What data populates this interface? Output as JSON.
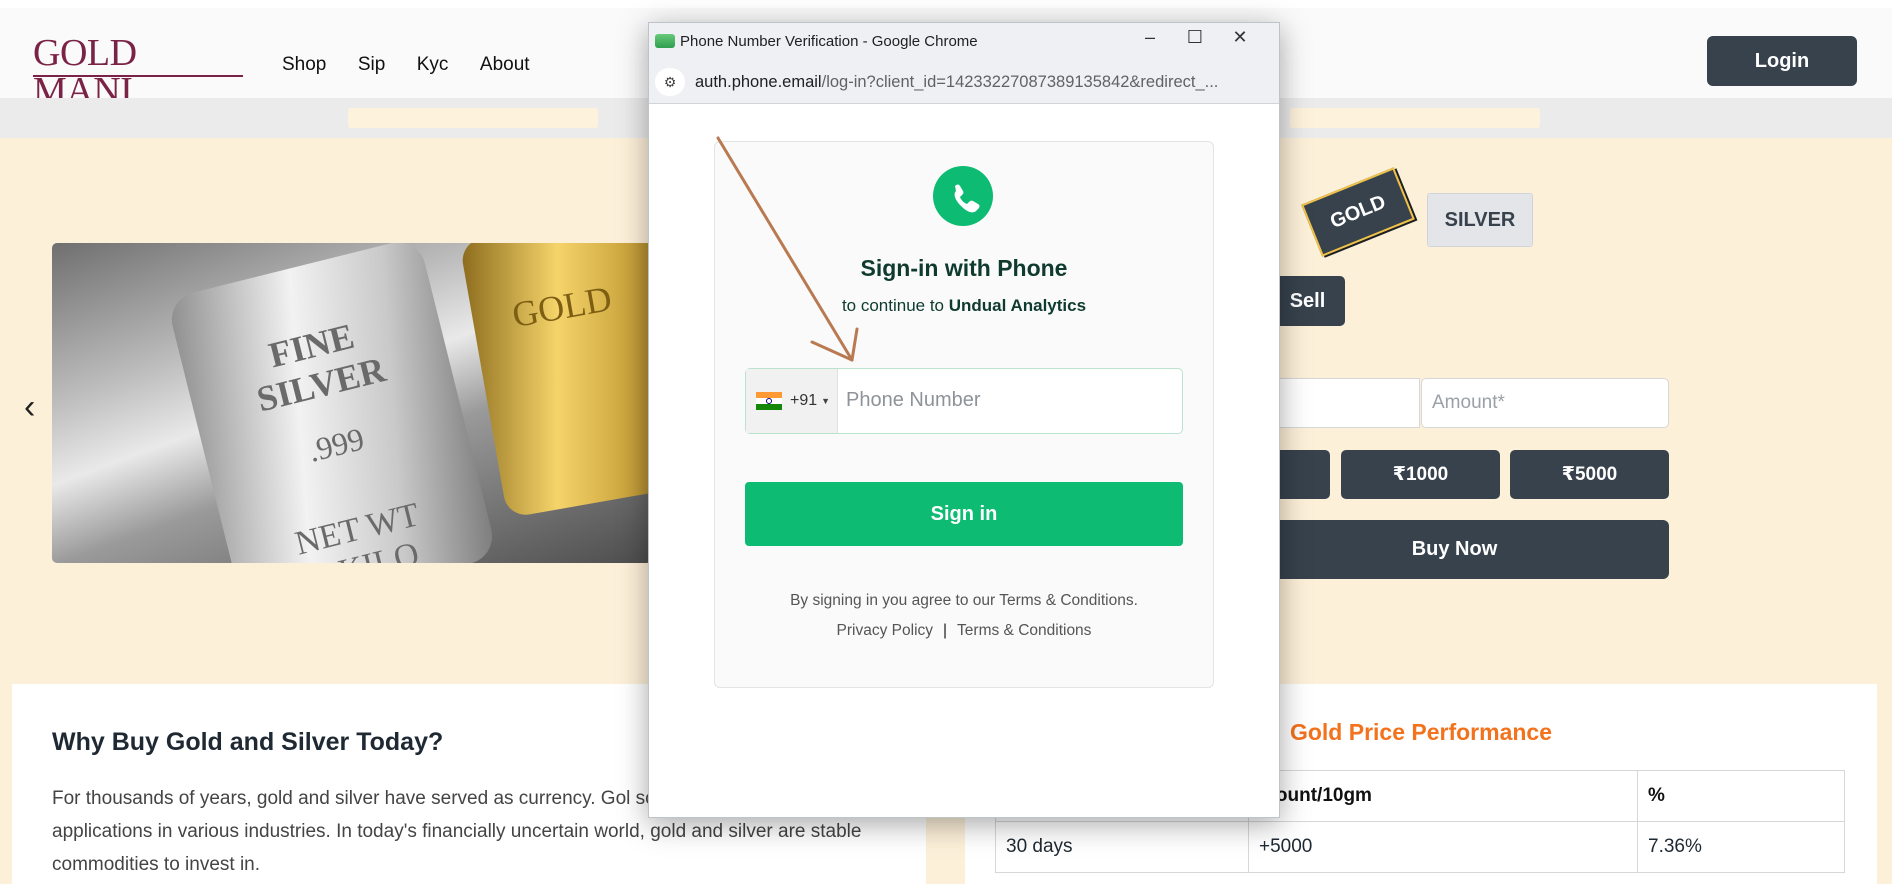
{
  "site": {
    "logo": "GOLD MANI",
    "nav": [
      "Shop",
      "Sip",
      "Kyc",
      "About"
    ],
    "login_label": "Login"
  },
  "trade": {
    "metal_tabs": [
      "GOLD",
      "SILVER"
    ],
    "sell_label": "Sell",
    "amount_placeholder": "Amount*",
    "quick_amounts": [
      "₹1000",
      "₹5000"
    ],
    "buy_label": "Buy Now"
  },
  "why": {
    "title": "Why Buy Gold and Silver Today?",
    "body": "For thousands of years, gold and silver have served as currency. Gol scarce, finite, and finds applications in various industries. In today's financially uncertain world, gold and silver are stable commodities to invest in."
  },
  "performance": {
    "title": "Gold Price Performance",
    "headers": [
      "",
      "mount/10gm",
      "%"
    ],
    "rows": [
      [
        "30 days",
        "+5000",
        "7.36%"
      ]
    ]
  },
  "popup": {
    "window_title": "Phone Number Verification - Google Chrome",
    "url_domain": "auth.phone.email",
    "url_path": "/log-in?client_id=14233227087389135842&redirect_...",
    "signin_title": "Sign-in with Phone",
    "signin_sub_prefix": "to continue to ",
    "signin_sub_app": "Undual Analytics",
    "country_code": "+91",
    "phone_placeholder": "Phone Number",
    "signin_button": "Sign in",
    "agree_text": "By signing in you agree to our Terms & Conditions.",
    "privacy_link": "Privacy Policy",
    "terms_link": "Terms & Conditions"
  },
  "colors": {
    "page_bg": "#fdf0d9",
    "dark_button": "#37424d",
    "brand_green": "#0dbb73",
    "accent_orange": "#f2721d",
    "annotation_arrow": "#b97a52"
  }
}
